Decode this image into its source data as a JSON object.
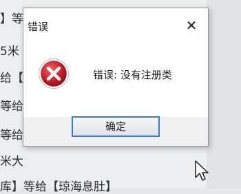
{
  "background": {
    "lines": [
      "】等",
      "5米",
      "给【",
      "等给",
      "等给",
      "米大",
      "库】等给【琼海息肚】"
    ]
  },
  "dialog": {
    "title": "错误",
    "close_glyph": "✕",
    "message": "错误: 没有注册类",
    "ok_label": "确定",
    "icon": "error-icon"
  },
  "colors": {
    "accent": "#3b7bd6",
    "error_red": "#c8202a"
  }
}
